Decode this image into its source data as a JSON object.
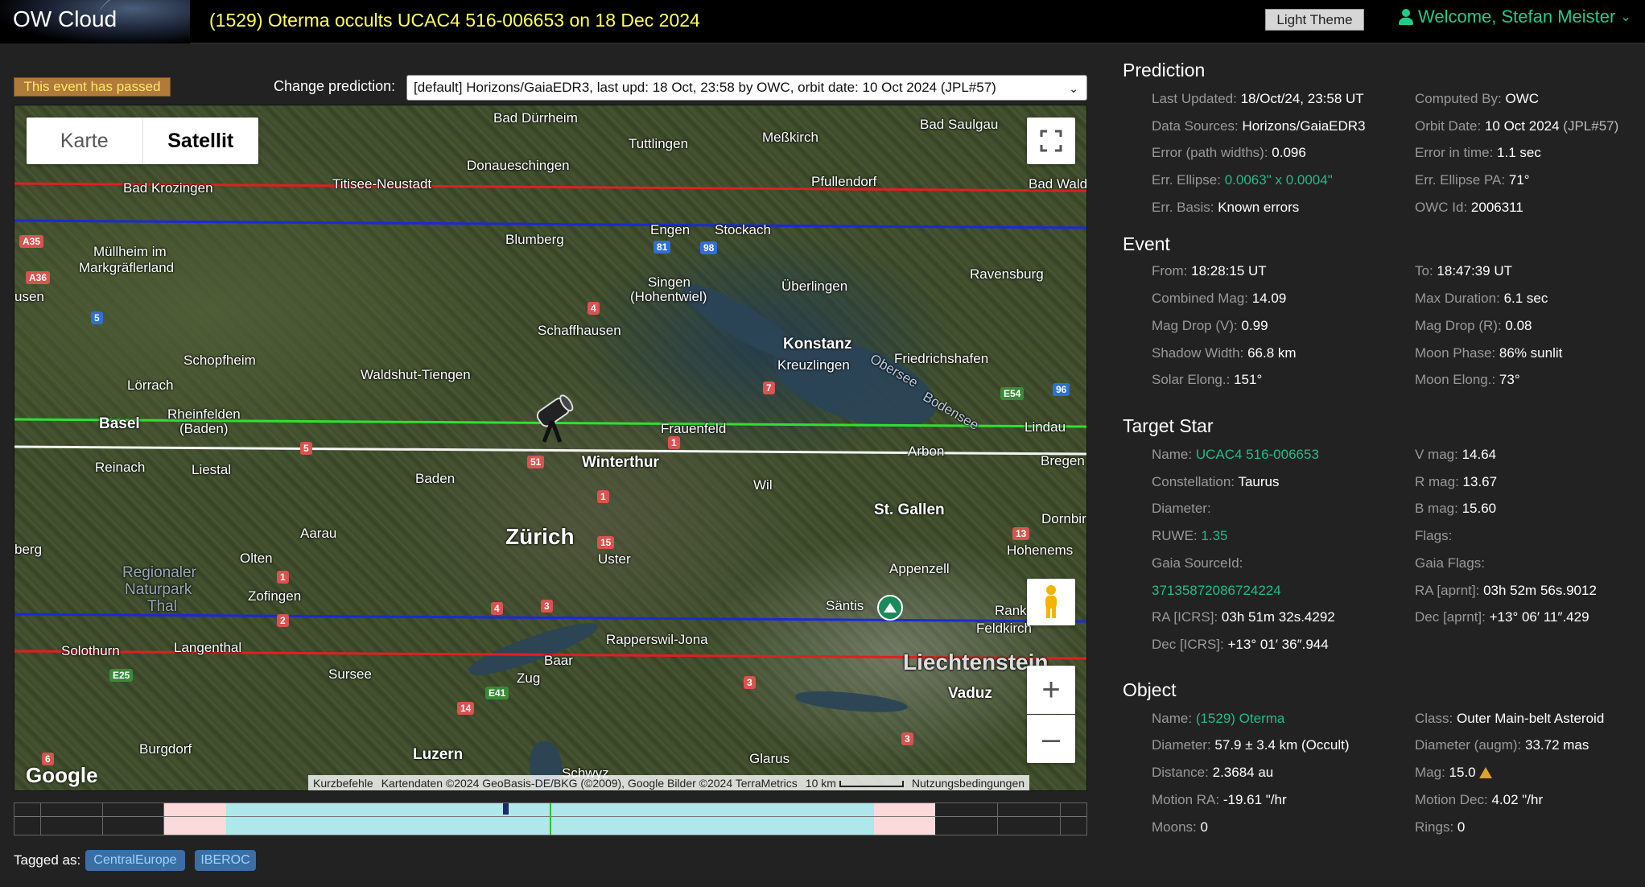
{
  "header": {
    "logo": "OW Cloud",
    "title": "(1529) Oterma occults UCAC4 516-006653 on 18 Dec 2024",
    "theme_button": "Light Theme",
    "welcome": "Welcome, Stefan Meister",
    "accent_color": "#22cc88",
    "title_color": "#ffff55"
  },
  "event_status": "This event has passed",
  "change_prediction": {
    "label": "Change prediction:",
    "selected": "[default] Horizons/GaiaEDR3, last upd: 18 Oct, 23:58 by OWC, orbit date: 10 Oct 2024 (JPL#57)"
  },
  "map": {
    "tabs": [
      "Karte",
      "Satellit"
    ],
    "active_tab": "Satellit",
    "footer": {
      "shortcuts": "Kurzbefehle",
      "attribution": "Kartendaten ©2024 GeoBasis-DE/BKG (©2009), Google Bilder ©2024 TerraMetrics",
      "scale": "10 km",
      "terms": "Nutzungsbedingungen"
    },
    "google": "Google",
    "places": [
      "Bad Dürrheim",
      "Tuttlingen",
      "Meßkirch",
      "Bad Saulgau",
      "Donaueschingen",
      "Pfullendorf",
      "Bad Krozingen",
      "Titisee-Neustadt",
      "Bad Wald",
      "Engen",
      "Stockach",
      "Blumberg",
      "Müllheim im",
      "Markgräflerland",
      "Singen",
      "(Hohentwiel)",
      "Überlingen",
      "Ravensburg",
      "usen",
      "Schaffhausen",
      "Konstanz",
      "Friedrichshafen",
      "Schopfheim",
      "Waldshut-Tiengen",
      "Kreuzlingen",
      "Obersee",
      "Lörrach",
      "Rheinfelden",
      "(Baden)",
      "Basel",
      "Frauenfeld",
      "Lindau",
      "Bodensee",
      "Arbon",
      "Bregen",
      "Reinach",
      "Liestal",
      "Winterthur",
      "Baden",
      "Wil",
      "St. Gallen",
      "Dornbir",
      "Aarau",
      "Zürich",
      "Uster",
      "Hohenems",
      "berg",
      "Olten",
      "Regionaler",
      "Naturpark",
      "Thal",
      "Appenzell",
      "Zofingen",
      "Säntis",
      "Rank",
      "Feldkirch",
      "Solothurn",
      "Langenthal",
      "Rapperswil-Jona",
      "Liechtenstein",
      "Baar",
      "Sursee",
      "Zug",
      "Vaduz",
      "Burgdorf",
      "Luzern",
      "Schwyz",
      "Glarus"
    ],
    "roads": [
      "A35",
      "A36",
      "5",
      "81",
      "98",
      "4",
      "7",
      "E54",
      "96",
      "5",
      "51",
      "1",
      "1",
      "15",
      "13",
      "1",
      "4",
      "3",
      "2",
      "E25",
      "E41",
      "14",
      "3",
      "6",
      "3"
    ]
  },
  "timeline": {},
  "tags": {
    "label": "Tagged as:",
    "items": [
      "CentralEurope",
      "IBEROC"
    ]
  },
  "prediction": {
    "title": "Prediction",
    "last_updated": {
      "k": "Last Updated:",
      "v": "18/Oct/24, 23:58 UT"
    },
    "computed_by": {
      "k": "Computed By:",
      "v": "OWC"
    },
    "data_sources": {
      "k": "Data Sources:",
      "v": "Horizons/GaiaEDR3"
    },
    "orbit_date": {
      "k": "Orbit Date:",
      "v": "10 Oct 2024",
      "v2": "(JPL#57)"
    },
    "error_path": {
      "k": "Error (path widths):",
      "v": "0.096"
    },
    "error_time": {
      "k": "Error in time:",
      "v": "1.1 sec"
    },
    "err_ellipse": {
      "k": "Err. Ellipse:",
      "v": "0.0063\" x 0.0004\""
    },
    "err_ellipse_pa": {
      "k": "Err. Ellipse PA:",
      "v": "71°"
    },
    "err_basis": {
      "k": "Err. Basis:",
      "v": "Known errors"
    },
    "owc_id": {
      "k": "OWC Id:",
      "v": "2006311"
    }
  },
  "event": {
    "title": "Event",
    "from": {
      "k": "From:",
      "v": "18:28:15 UT"
    },
    "to": {
      "k": "To:",
      "v": "18:47:39 UT"
    },
    "combined_mag": {
      "k": "Combined Mag:",
      "v": "14.09"
    },
    "max_duration": {
      "k": "Max Duration:",
      "v": "6.1 sec"
    },
    "mag_drop_v": {
      "k": "Mag Drop (V):",
      "v": "0.99"
    },
    "mag_drop_r": {
      "k": "Mag Drop (R):",
      "v": "0.08"
    },
    "shadow_width": {
      "k": "Shadow Width:",
      "v": "66.8 km"
    },
    "moon_phase": {
      "k": "Moon Phase:",
      "v": "86% sunlit"
    },
    "solar_elong": {
      "k": "Solar Elong.:",
      "v": "151°"
    },
    "moon_elong": {
      "k": "Moon Elong.:",
      "v": "73°"
    }
  },
  "target_star": {
    "title": "Target Star",
    "name": {
      "k": "Name:",
      "v": "UCAC4 516-006653"
    },
    "vmag": {
      "k": "V mag:",
      "v": "14.64"
    },
    "constellation": {
      "k": "Constellation:",
      "v": "Taurus"
    },
    "rmag": {
      "k": "R mag:",
      "v": "13.67"
    },
    "diameter": {
      "k": "Diameter:",
      "v": ""
    },
    "bmag": {
      "k": "B mag:",
      "v": "15.60"
    },
    "ruwe": {
      "k": "RUWE:",
      "v": "1.35"
    },
    "flags": {
      "k": "Flags:",
      "v": ""
    },
    "gaia_source_id": {
      "k": "Gaia SourceId:",
      "v": "37135872086724224"
    },
    "gaia_flags": {
      "k": "Gaia Flags:",
      "v": ""
    },
    "ra_icrs": {
      "k": "RA [ICRS]:",
      "v": "03h 51m 32s.4292"
    },
    "ra_aprnt": {
      "k": "RA [aprnt]:",
      "v": "03h 52m 56s.9012"
    },
    "dec_icrs": {
      "k": "Dec [ICRS]:",
      "v": "+13° 01′ 36″.944"
    },
    "dec_aprnt": {
      "k": "Dec [aprnt]:",
      "v": "+13° 06′ 11″.429"
    }
  },
  "object": {
    "title": "Object",
    "name": {
      "k": "Name:",
      "v": "(1529) Oterma"
    },
    "class": {
      "k": "Class:",
      "v": "Outer Main-belt Asteroid"
    },
    "diameter": {
      "k": "Diameter:",
      "v": "57.9 ± 3.4 km (Occult)"
    },
    "diameter_augm": {
      "k": "Diameter (augm):",
      "v": "33.72 mas"
    },
    "distance": {
      "k": "Distance:",
      "v": "2.3684 au"
    },
    "mag": {
      "k": "Mag:",
      "v": "15.0"
    },
    "motion_ra": {
      "k": "Motion RA:",
      "v": "-19.61 \"/hr"
    },
    "motion_dec": {
      "k": "Motion Dec:",
      "v": "4.02 \"/hr"
    },
    "moons": {
      "k": "Moons:",
      "v": "0"
    },
    "rings": {
      "k": "Rings:",
      "v": "0"
    }
  }
}
